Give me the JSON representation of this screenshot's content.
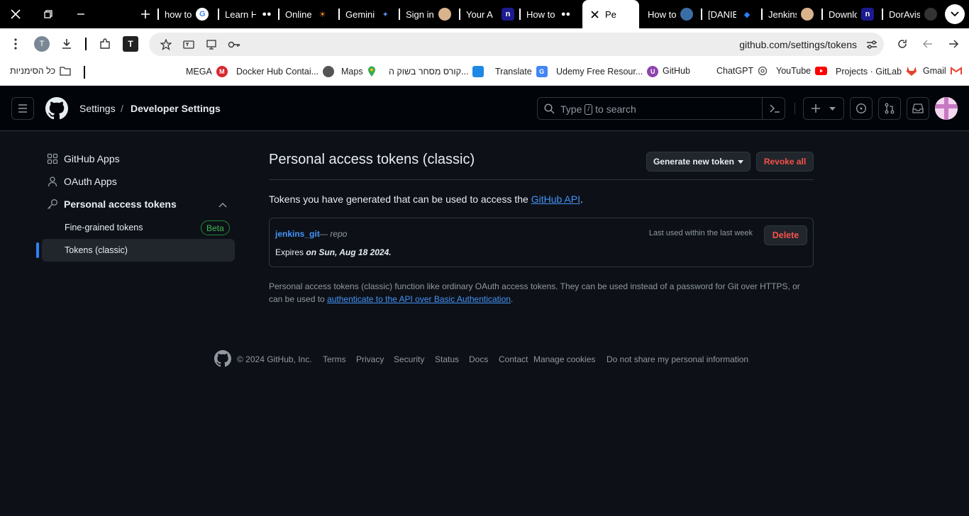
{
  "browser": {
    "tabs": [
      {
        "label": "how to",
        "icon": "google-icon"
      },
      {
        "label": "Learn H",
        "icon": "medium-icon"
      },
      {
        "label": "Online",
        "icon": "sun-icon"
      },
      {
        "label": "Gemini",
        "icon": "gemini-icon"
      },
      {
        "label": "Sign in",
        "icon": "jenkins-icon"
      },
      {
        "label": "Your A",
        "icon": "nexus-icon"
      },
      {
        "label": "How to",
        "icon": "medium-icon"
      },
      {
        "label": "Pe",
        "icon": "github-icon",
        "active": true
      },
      {
        "label": "How to",
        "icon": "docker-icon"
      },
      {
        "label": "[DANIE",
        "icon": "jira-icon"
      },
      {
        "label": "Jenkins",
        "icon": "jenkins-icon"
      },
      {
        "label": "Downlo",
        "icon": "nexus-icon"
      },
      {
        "label": "DorAvis",
        "icon": "github-icon"
      }
    ],
    "avatar_letter": "T",
    "url": "github.com/settings/tokens",
    "bookmarks": [
      {
        "label": "MEGA",
        "icon": "mega-icon",
        "color": "#d9272e"
      },
      {
        "label": "Docker Hub Contai...",
        "icon": "docker-icon",
        "color": "#555555"
      },
      {
        "label": "Maps",
        "icon": "maps-icon",
        "color": "#34a853"
      },
      {
        "label": "קורס מסחר בשוק ה...",
        "icon": "course-icon",
        "color": "#1e88e5"
      },
      {
        "label": "Translate",
        "icon": "translate-icon",
        "color": "#4285f4"
      },
      {
        "label": "Udemy Free Resour...",
        "icon": "udemy-icon",
        "color": "#8e44ad"
      },
      {
        "label": "GitHub",
        "icon": "github-icon",
        "color": "#ffffff"
      },
      {
        "label": "ChatGPT",
        "icon": "chatgpt-icon",
        "color": "#666666"
      },
      {
        "label": "YouTube",
        "icon": "youtube-icon",
        "color": "#ff0000"
      },
      {
        "label": "Projects · GitLab",
        "icon": "gitlab-icon",
        "color": "#e24329"
      },
      {
        "label": "Gmail",
        "icon": "gmail-icon",
        "color": "#ea4335"
      }
    ],
    "all_bookmarks_label": "כל הסימניות"
  },
  "header": {
    "crumb_settings": "Settings",
    "crumb_sep": "/",
    "crumb_developer": "Developer Settings",
    "search_prefix": "Type",
    "search_key": "/",
    "search_suffix": "to search"
  },
  "sidebar": {
    "github_apps": "GitHub Apps",
    "oauth_apps": "OAuth Apps",
    "pat": "Personal access tokens",
    "fine_grained": "Fine-grained tokens",
    "beta": "Beta",
    "classic": "Tokens (classic)"
  },
  "main": {
    "title": "Personal access tokens (classic)",
    "generate_button": "Generate new token",
    "revoke_button": "Revoke all",
    "intro_text": "Tokens you have generated that can be used to access the",
    "intro_link": "GitHub API",
    "intro_end": ".",
    "token": {
      "name": "jenkins_git",
      "scope": "— repo",
      "last_used": "Last used within the last week",
      "delete": "Delete",
      "expires_prefix": "Expires",
      "expires_date": "on Sun, Aug 18 2024."
    },
    "note_text": "Personal access tokens (classic) function like ordinary OAuth access tokens. They can be used instead of a password for Git over HTTPS, or can be used to",
    "note_link": "authenticate to the API over Basic Authentication",
    "note_end": "."
  },
  "footer": {
    "copyright": "© 2024 GitHub, Inc.",
    "links": [
      "Terms",
      "Privacy",
      "Security",
      "Status",
      "Docs",
      "Contact",
      "Manage cookies",
      "Do not share my personal information"
    ]
  },
  "colors": {
    "background": "#0d1117",
    "accent_blue": "#4493f8",
    "danger": "#f85149",
    "beta_green": "#3fb950"
  }
}
